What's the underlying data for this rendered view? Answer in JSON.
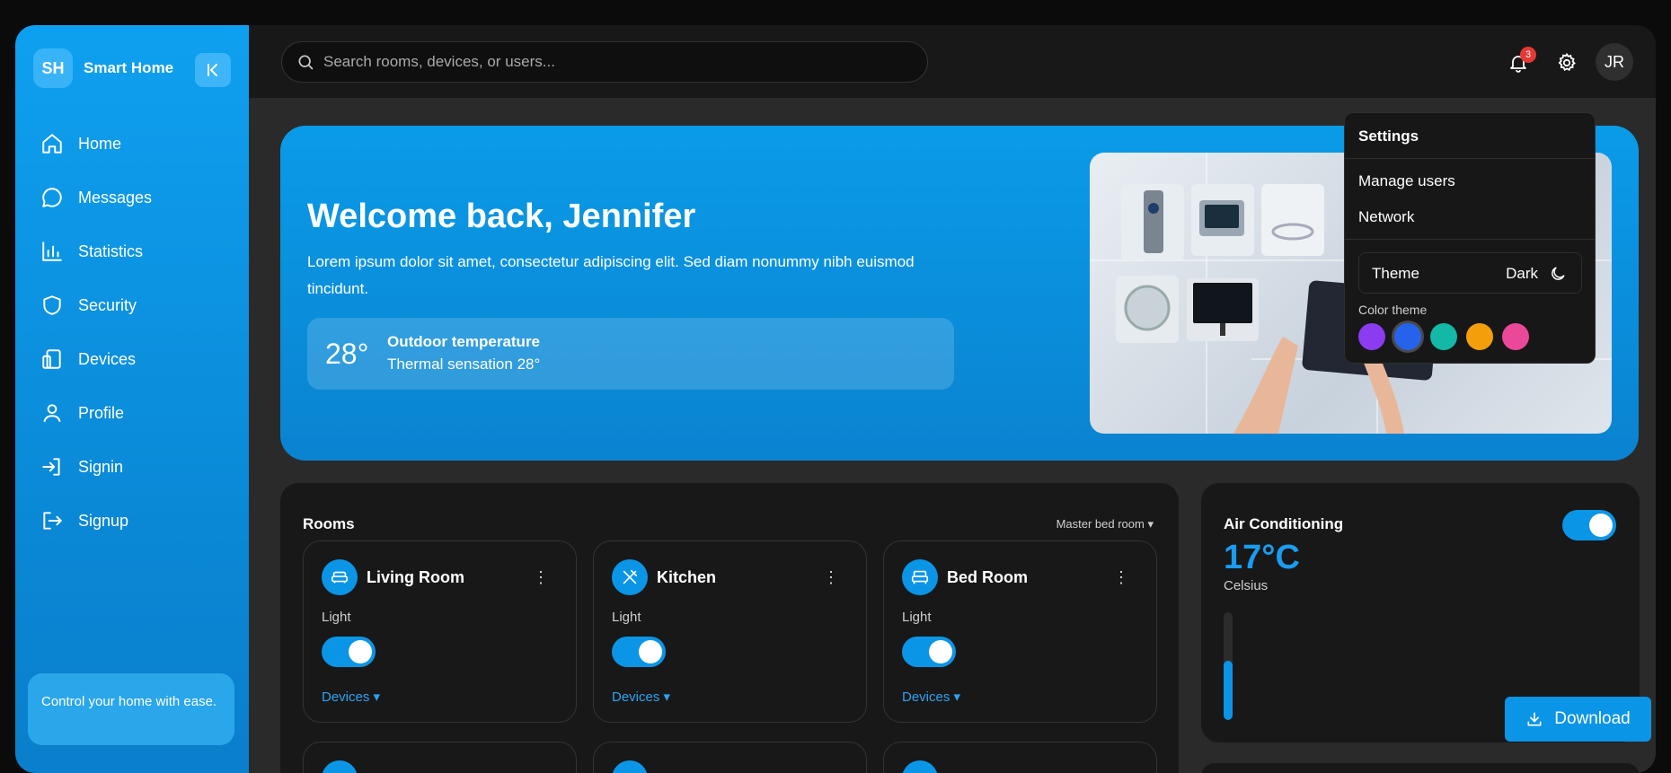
{
  "brand": {
    "logo": "SH",
    "name": "Smart Home"
  },
  "sidebar": {
    "items": [
      {
        "label": "Home",
        "icon": "home-icon"
      },
      {
        "label": "Messages",
        "icon": "message-icon"
      },
      {
        "label": "Statistics",
        "icon": "chart-icon"
      },
      {
        "label": "Security",
        "icon": "shield-icon"
      },
      {
        "label": "Devices",
        "icon": "devices-icon"
      },
      {
        "label": "Profile",
        "icon": "user-icon"
      },
      {
        "label": "Signin",
        "icon": "signin-icon"
      },
      {
        "label": "Signup",
        "icon": "signup-icon"
      }
    ],
    "promo": "Control your home with ease."
  },
  "header": {
    "search_placeholder": "Search rooms, devices, or users...",
    "notification_count": "3",
    "avatar": "JR"
  },
  "hero": {
    "title": "Welcome back, Jennifer",
    "text": "Lorem ipsum dolor sit amet, consectetur adipiscing elit. Sed diam nonummy nibh euismod tincidunt.",
    "temperature": "28°",
    "temp_label": "Outdoor temperature",
    "temp_sub": "Thermal sensation 28°"
  },
  "rooms": {
    "title": "Rooms",
    "filter": "Master bed room",
    "items": [
      {
        "name": "Living Room",
        "light_label": "Light",
        "light_on": true,
        "devices_label": "Devices"
      },
      {
        "name": "Kitchen",
        "light_label": "Light",
        "light_on": true,
        "devices_label": "Devices"
      },
      {
        "name": "Bed Room",
        "light_label": "Light",
        "light_on": true,
        "devices_label": "Devices"
      }
    ]
  },
  "ac": {
    "title": "Air Conditioning",
    "temperature": "17°C",
    "unit": "Celsius",
    "on": true,
    "level": 0.55
  },
  "download": {
    "label": "Download"
  },
  "settings_menu": {
    "title": "Settings",
    "items": [
      "Manage users",
      "Network"
    ],
    "theme_label": "Theme",
    "theme_value": "Dark",
    "color_label": "Color theme",
    "colors": [
      "#8b3cf0",
      "#2563eb",
      "#14b8a6",
      "#f59e0b",
      "#ec4899"
    ],
    "selected_color": 1
  },
  "colors": {
    "accent": "#0b95e6",
    "sidebar": "#0a8fdc",
    "panel": "#181818"
  }
}
